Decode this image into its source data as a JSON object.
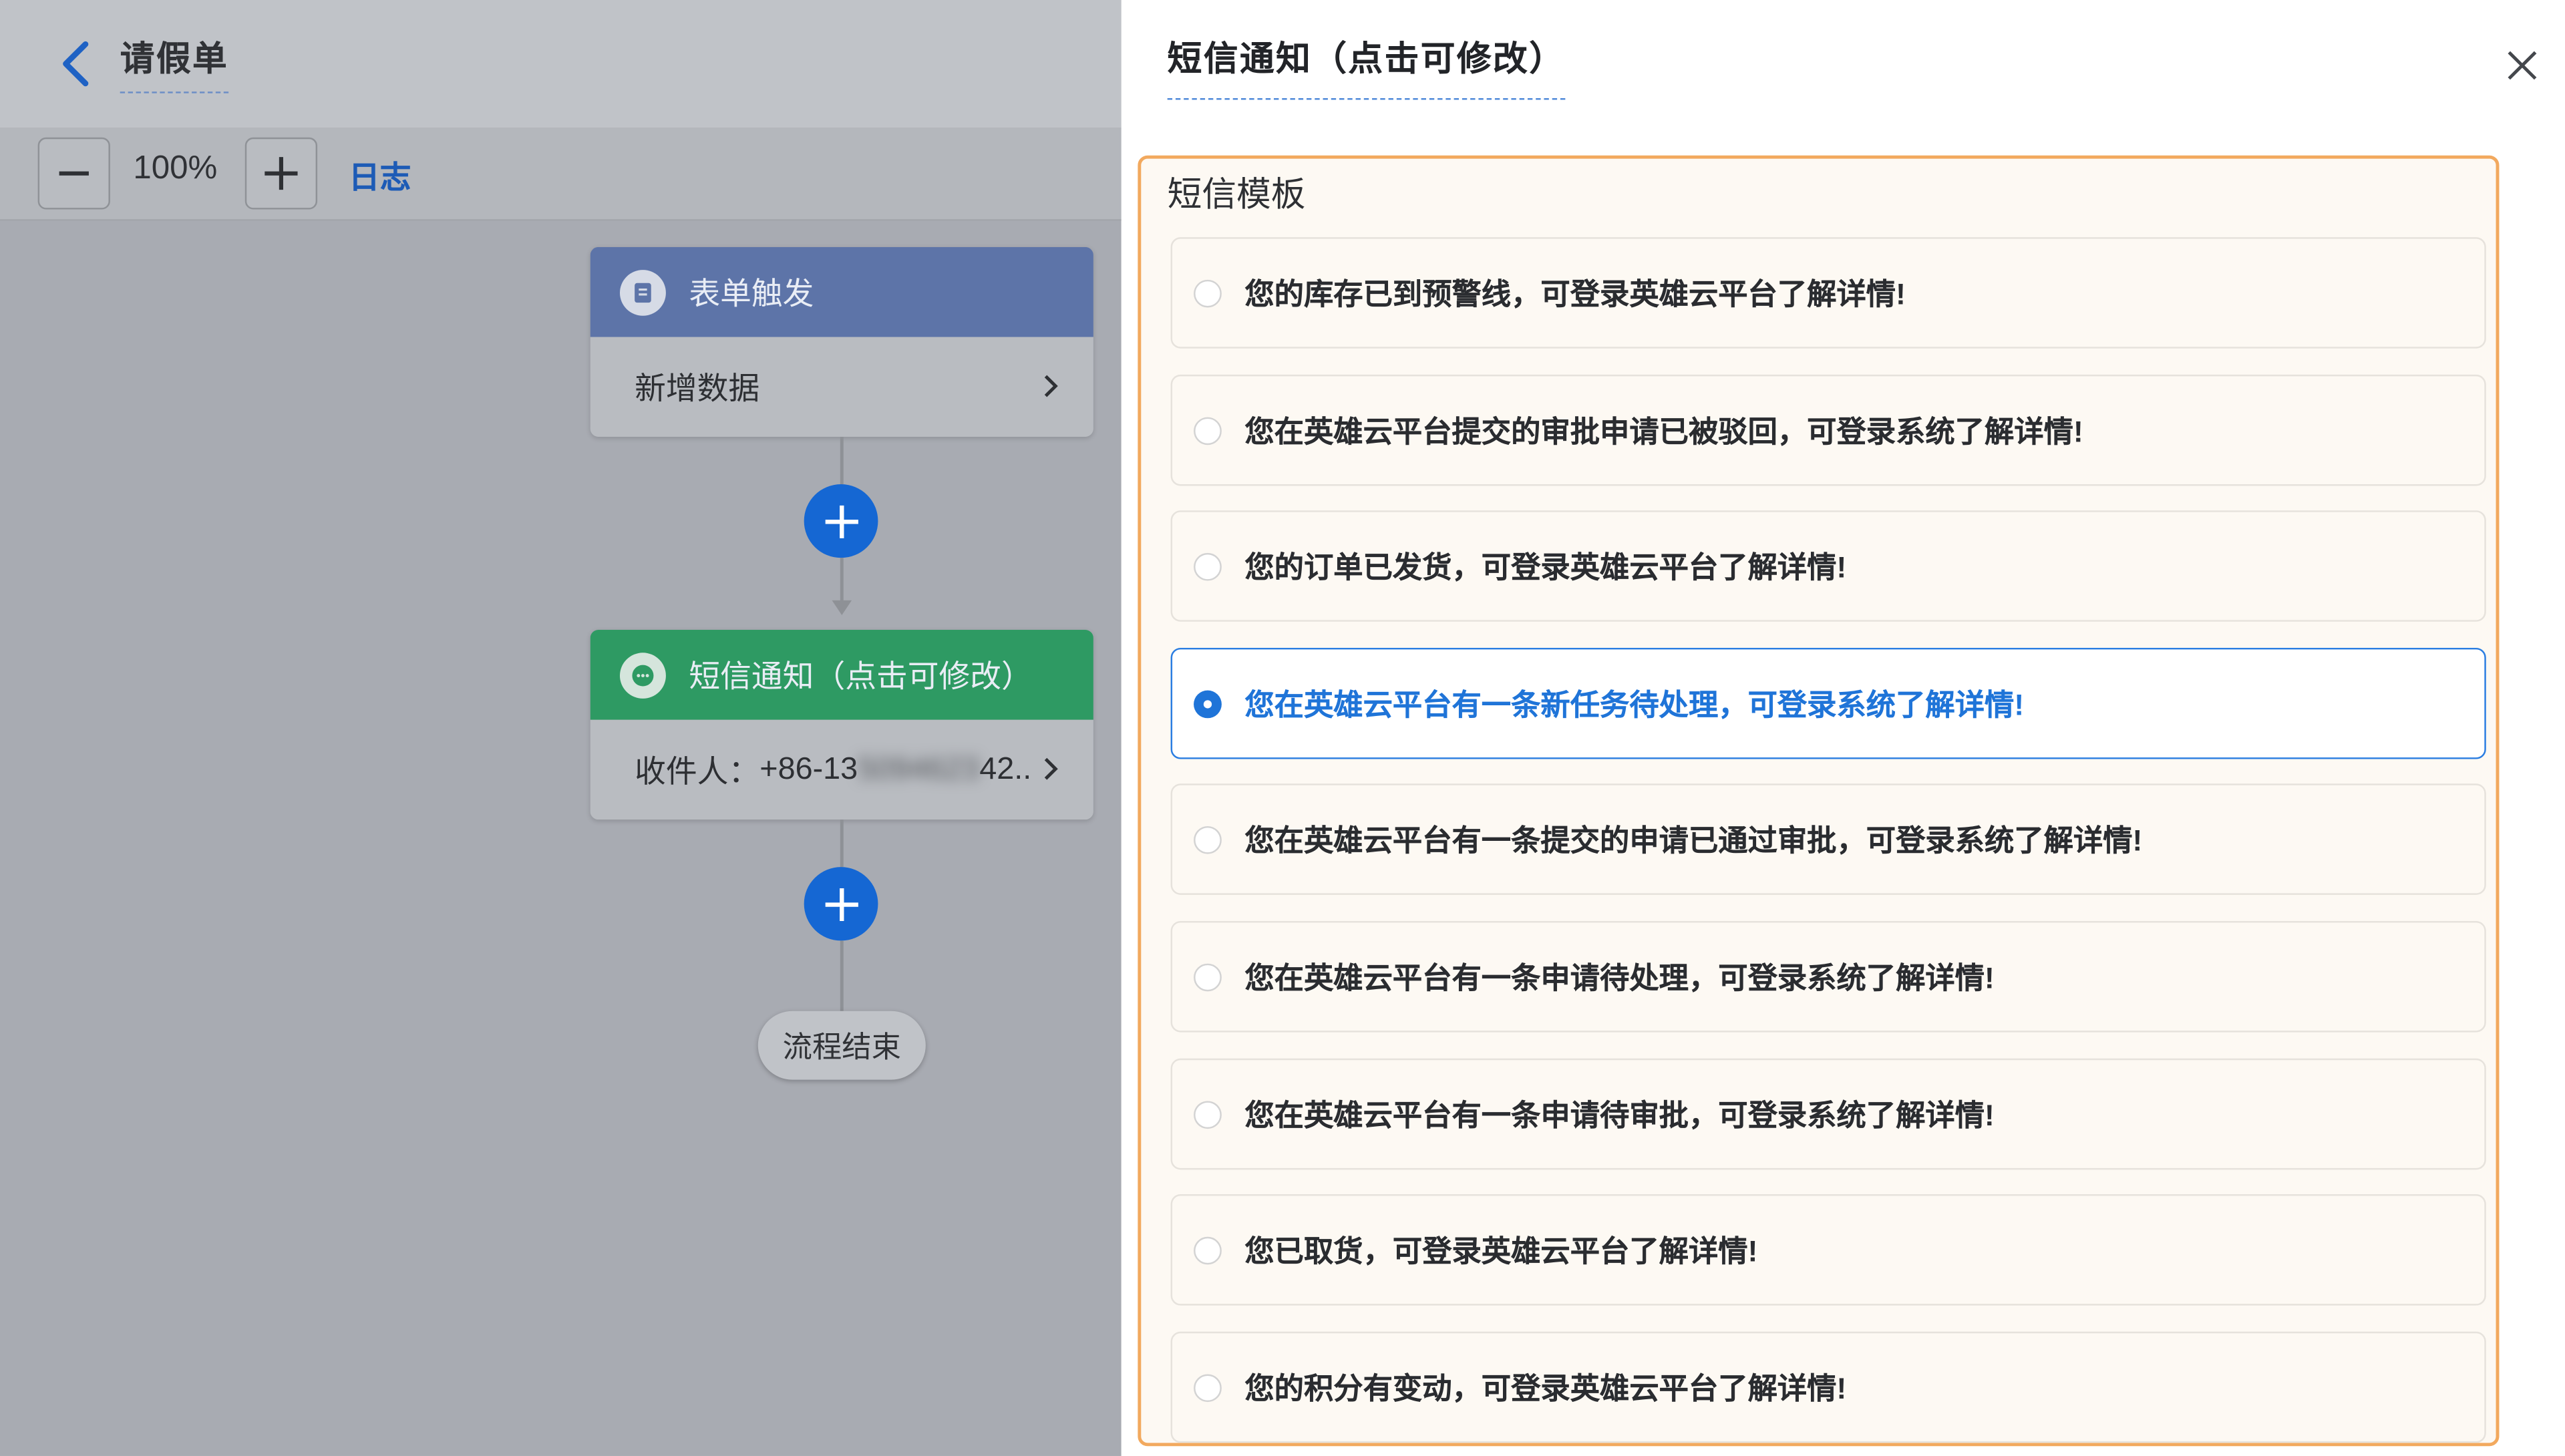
{
  "left": {
    "form_title": "请假单",
    "zoom_level": "100%",
    "log_link": "日志",
    "trigger_node": {
      "title": "表单触发",
      "body": "新增数据",
      "color": "#5d74a8"
    },
    "sms_node": {
      "title": "短信通知（点击可修改）",
      "recipient_label": "收件人：",
      "recipient_prefix": "+86-13",
      "recipient_hidden": "5094623",
      "recipient_suffix": "42..",
      "color": "#2e9a63"
    },
    "end_label": "流程结束"
  },
  "panel": {
    "title": "短信通知（点击可修改）",
    "section_label": "短信模板",
    "options": [
      {
        "text": "您的库存已到预警线，可登录英雄云平台了解详情!",
        "selected": false
      },
      {
        "text": "您在英雄云平台提交的审批申请已被驳回，可登录系统了解详情!",
        "selected": false
      },
      {
        "text": "您的订单已发货，可登录英雄云平台了解详情!",
        "selected": false
      },
      {
        "text": "您在英雄云平台有一条新任务待处理，可登录系统了解详情!",
        "selected": true
      },
      {
        "text": "您在英雄云平台有一条提交的申请已通过审批，可登录系统了解详情!",
        "selected": false
      },
      {
        "text": "您在英雄云平台有一条申请待处理，可登录系统了解详情!",
        "selected": false
      },
      {
        "text": "您在英雄云平台有一条申请待审批，可登录系统了解详情!",
        "selected": false
      },
      {
        "text": "您已取货，可登录英雄云平台了解详情!",
        "selected": false
      },
      {
        "text": "您的积分有变动，可登录英雄云平台了解详情!",
        "selected": false
      }
    ],
    "accent_color": "#1f74d8",
    "border_color": "#f2a95e"
  }
}
